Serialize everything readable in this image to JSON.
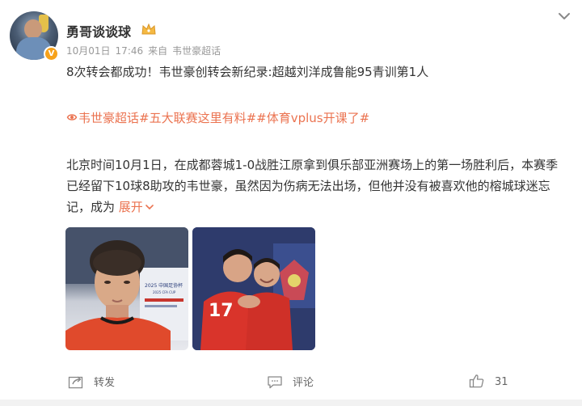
{
  "post": {
    "author": "勇哥谈谈球",
    "verified_badge": "V",
    "date": "10月01日",
    "time": "17:46",
    "source_prefix": "来自",
    "source": "韦世豪超话",
    "title": "8次转会都成功！韦世豪创转会新纪录:超越刘洋成鲁能95青训第1人",
    "tags": [
      "韦世豪超话",
      "#五大联赛这里有料#",
      "#体育vplus开课了#"
    ],
    "body": "北京时间10月1日，在成都蓉城1-0战胜江原拿到俱乐部亚洲赛场上的第一场胜利后，本赛季已经留下10球8助攻的韦世豪，虽然因为伤病无法出场，但他并没有被喜欢他的榕城球迷忘记，成为",
    "expand_label": "展开",
    "photos": [
      {
        "caption_line1": "2025 中国足协杯",
        "caption_line2": "2025 CFA CUP"
      },
      {
        "jersey_number": "17"
      }
    ]
  },
  "actions": {
    "repost_label": "转发",
    "comment_label": "评论",
    "like_count": "31"
  },
  "colors": {
    "accent": "#eb7350",
    "text": "#333333",
    "meta": "#999999"
  }
}
